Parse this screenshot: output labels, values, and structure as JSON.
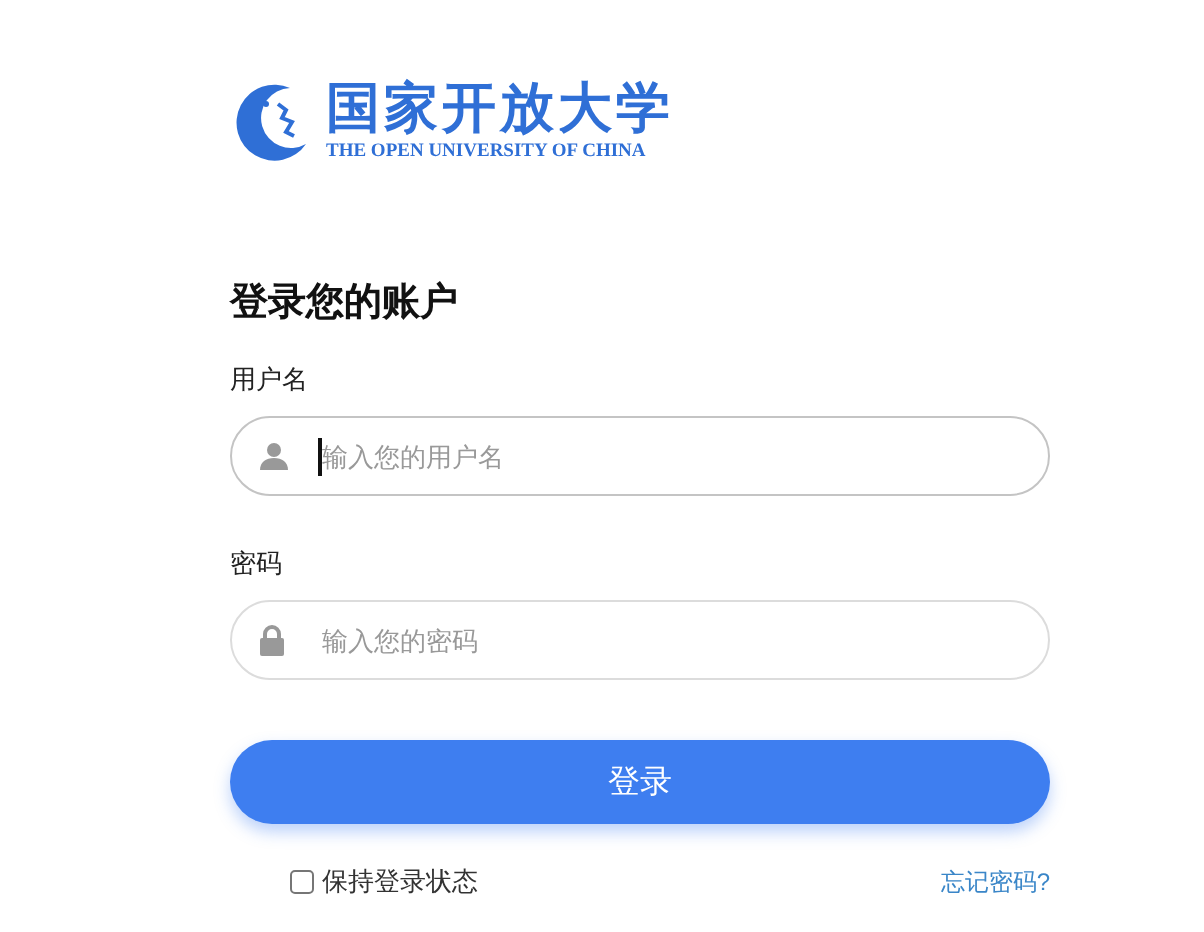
{
  "logo": {
    "name": "国家开放大学",
    "subtitle": "THE OPEN UNIVERSITY OF CHINA"
  },
  "heading": "登录您的账户",
  "fields": [
    {
      "kind": "user",
      "label": "用户名",
      "placeholder": "输入您的用户名",
      "focused": true
    },
    {
      "kind": "password",
      "label": "密码",
      "placeholder": "输入您的密码",
      "focused": false
    }
  ],
  "submit": "登录",
  "remember": {
    "label": "保持登录状态",
    "checked": false
  },
  "forgot": "忘记密码?"
}
